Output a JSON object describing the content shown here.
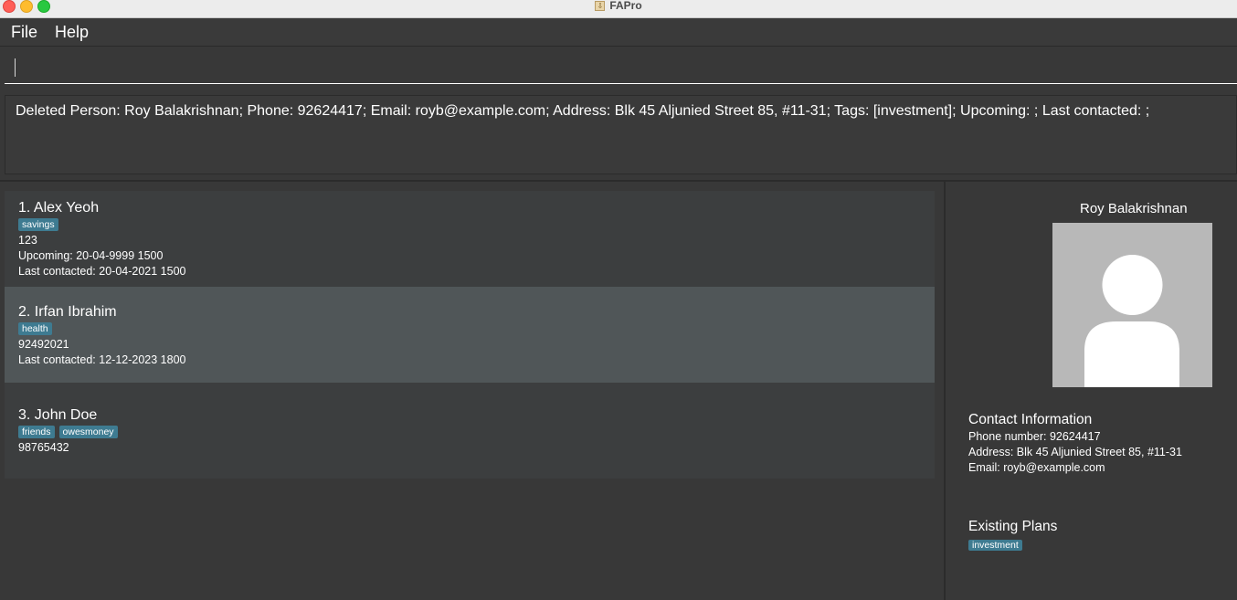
{
  "window": {
    "title": "FAPro"
  },
  "menu": {
    "file": "File",
    "help": "Help"
  },
  "command": {
    "value": ""
  },
  "result": {
    "text": "Deleted Person: Roy Balakrishnan; Phone: 92624417; Email: royb@example.com; Address: Blk 45 Aljunied Street 85, #11-31; Tags: [investment]; Upcoming: ; Last contacted: ;"
  },
  "persons": [
    {
      "index_name": "1.  Alex Yeoh",
      "tags": [
        "savings"
      ],
      "phone": "123",
      "upcoming": "Upcoming: 20-04-9999 1500",
      "last_contacted": "Last contacted: 20-04-2021 1500"
    },
    {
      "index_name": "2.  Irfan Ibrahim",
      "tags": [
        "health"
      ],
      "phone": "92492021",
      "last_contacted": "Last contacted: 12-12-2023 1800"
    },
    {
      "index_name": "3.  John Doe",
      "tags": [
        "friends",
        "owesmoney"
      ],
      "phone": "98765432"
    }
  ],
  "selected_index": 1,
  "detail": {
    "name": "Roy Balakrishnan",
    "contact_title": "Contact Information",
    "phone": "Phone number: 92624417",
    "address": "Address: Blk 45 Aljunied Street 85, #11-31",
    "email": "Email: royb@example.com",
    "plans_title": "Existing Plans",
    "plans": [
      "investment"
    ]
  },
  "colors": {
    "background": "#383838",
    "card": "#3c3e3f",
    "card_selected": "#505658",
    "tag": "#3e7b91",
    "avatar_bg": "#b8b8b8"
  }
}
